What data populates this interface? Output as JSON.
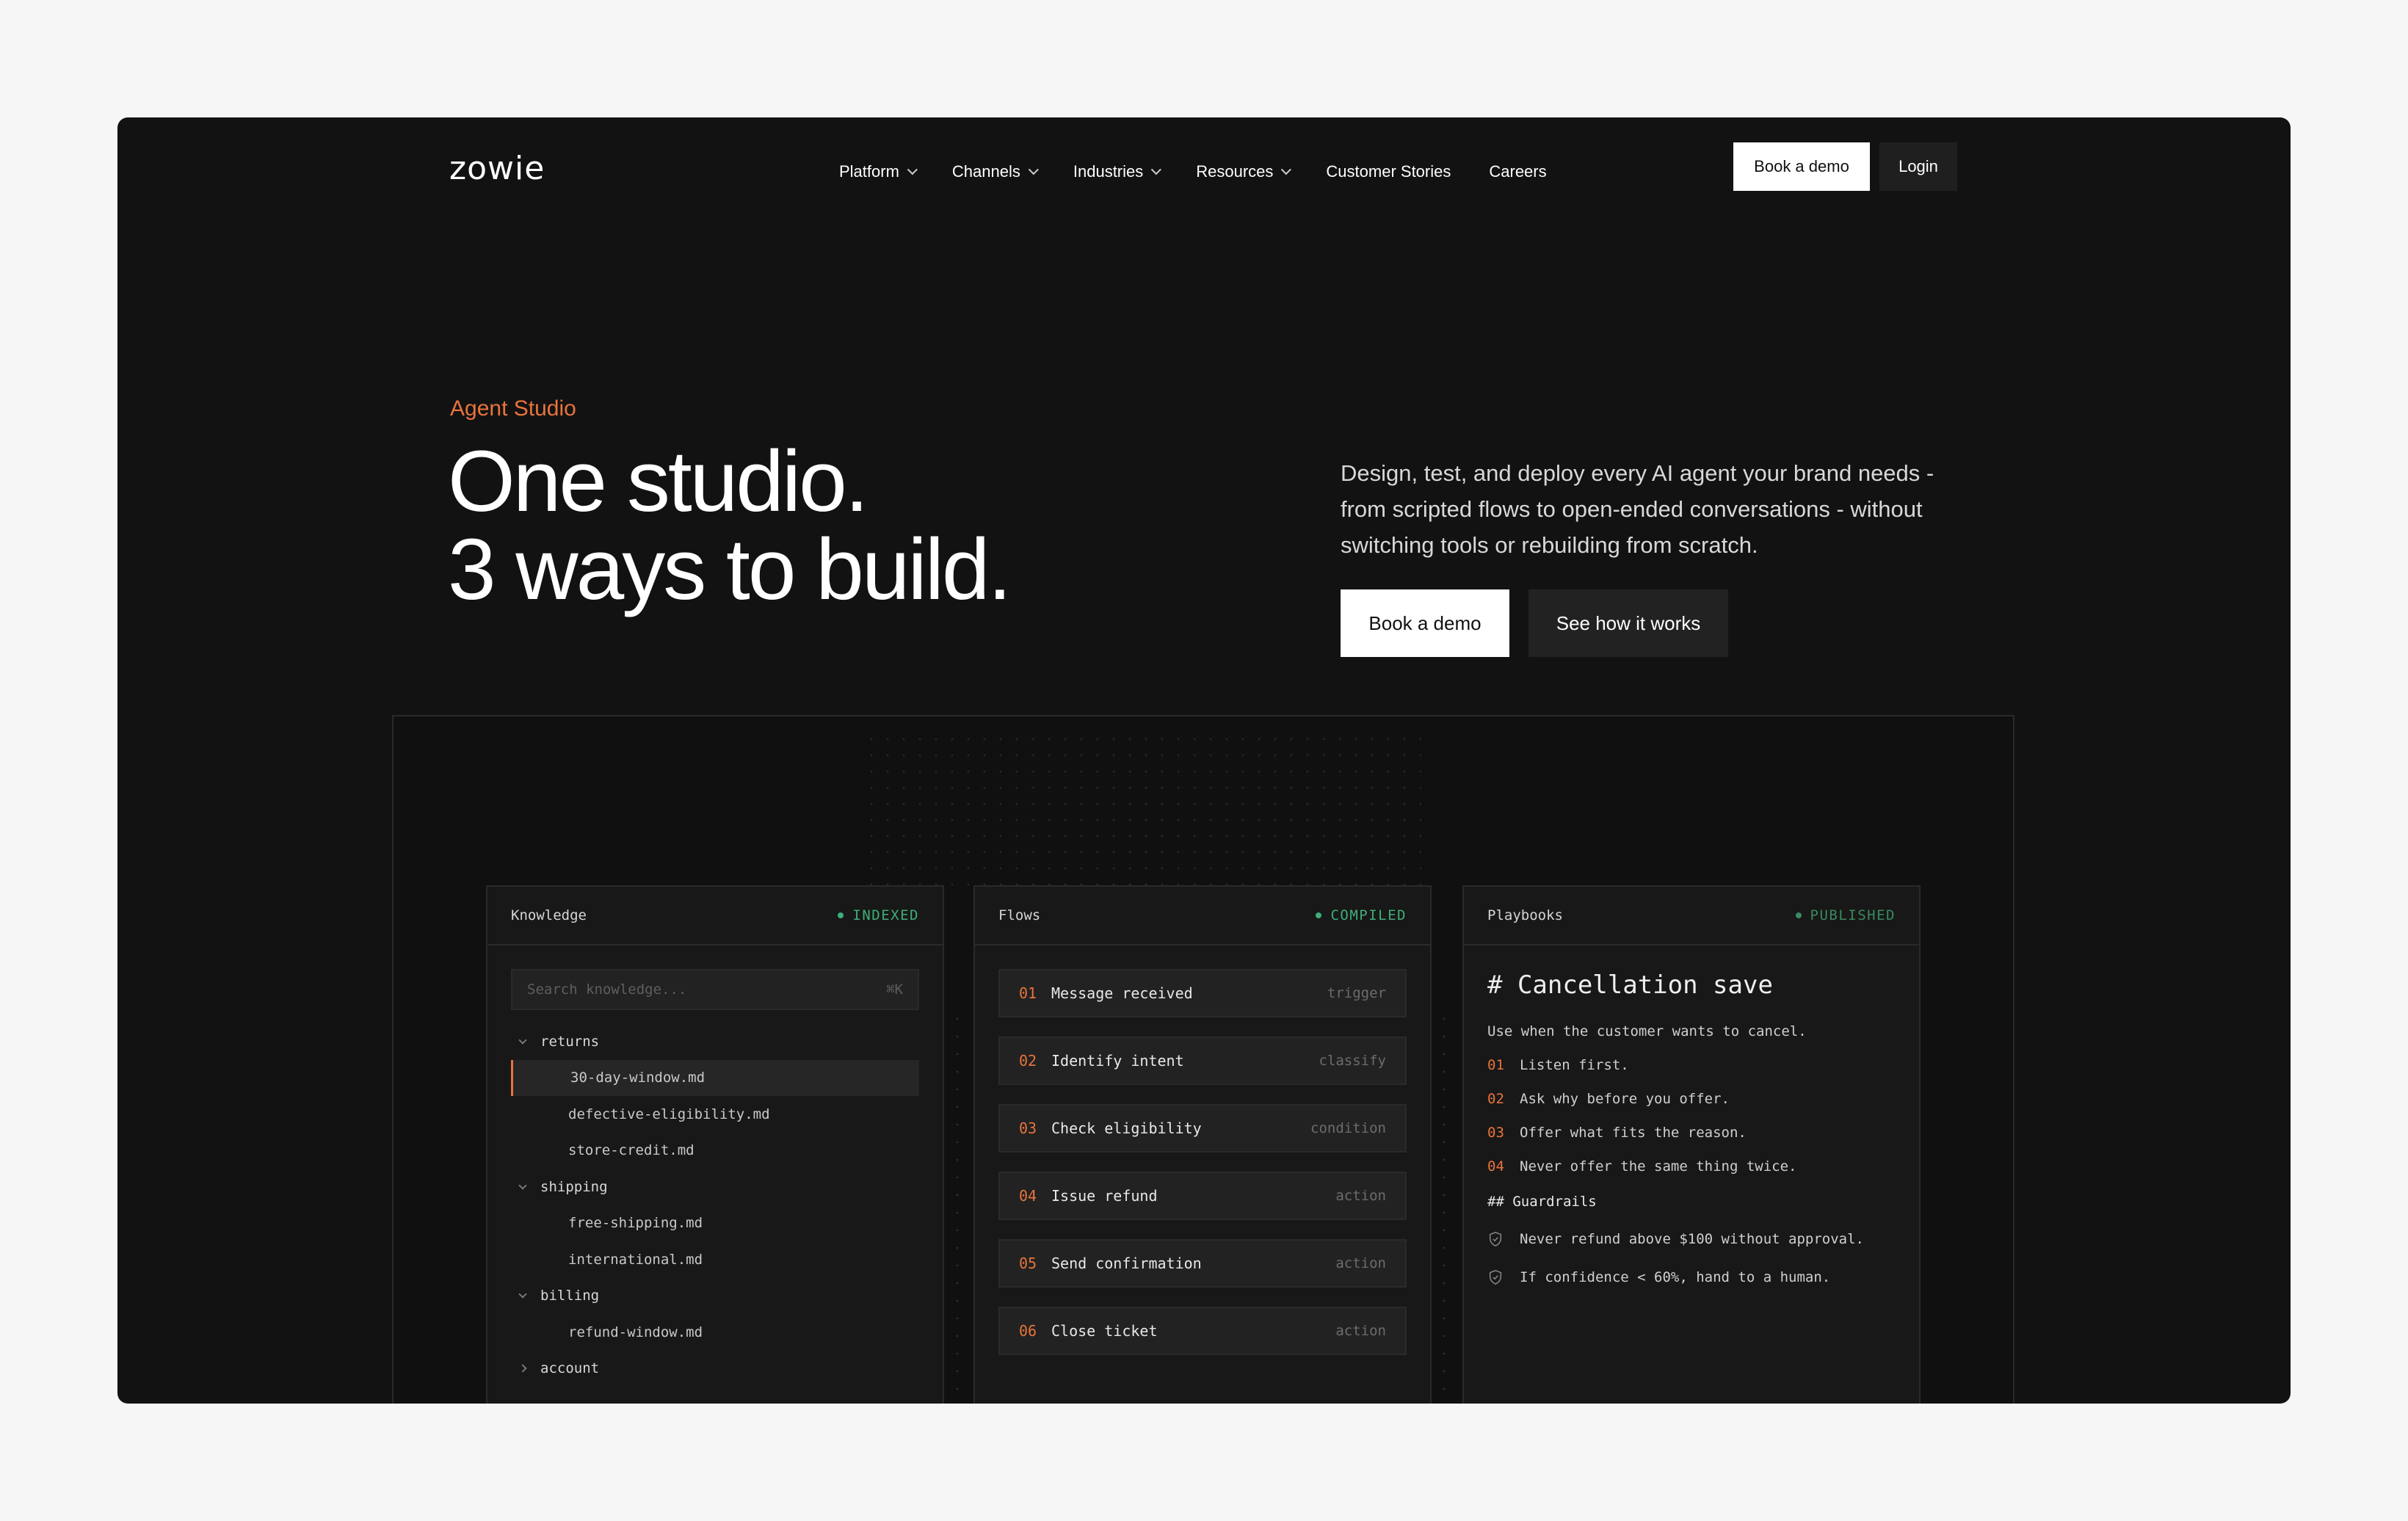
{
  "brand": {
    "logo": "zowie"
  },
  "nav": {
    "items": [
      {
        "label": "Platform",
        "dropdown": true
      },
      {
        "label": "Channels",
        "dropdown": true
      },
      {
        "label": "Industries",
        "dropdown": true
      },
      {
        "label": "Resources",
        "dropdown": true
      },
      {
        "label": "Customer Stories",
        "dropdown": false
      },
      {
        "label": "Careers",
        "dropdown": false
      }
    ],
    "book_demo": "Book a demo",
    "login": "Login"
  },
  "hero": {
    "eyebrow": "Agent Studio",
    "title_line1": "One studio.",
    "title_line2": "3 ways to build.",
    "subtitle": "Design, test, and deploy every AI agent your brand needs - from scripted flows to open-ended conversations - without switching tools or rebuilding from scratch.",
    "cta_primary": "Book a demo",
    "cta_secondary": "See how it works"
  },
  "colors": {
    "accent": "#e8743d",
    "status_green": "#3fae77",
    "background": "#121212"
  },
  "knowledge": {
    "title": "Knowledge",
    "status": "INDEXED",
    "search_placeholder": "Search knowledge...",
    "shortcut": "⌘K",
    "tree": [
      {
        "type": "folder",
        "label": "returns",
        "open": true
      },
      {
        "type": "file",
        "label": "30-day-window.md",
        "active": true
      },
      {
        "type": "file",
        "label": "defective-eligibility.md"
      },
      {
        "type": "file",
        "label": "store-credit.md"
      },
      {
        "type": "folder",
        "label": "shipping",
        "open": true
      },
      {
        "type": "file",
        "label": "free-shipping.md"
      },
      {
        "type": "file",
        "label": "international.md"
      },
      {
        "type": "folder",
        "label": "billing",
        "open": true
      },
      {
        "type": "file",
        "label": "refund-window.md"
      },
      {
        "type": "folder",
        "label": "account",
        "open": false
      }
    ]
  },
  "flows": {
    "title": "Flows",
    "status": "COMPILED",
    "steps": [
      {
        "num": "01",
        "label": "Message received",
        "tag": "trigger"
      },
      {
        "num": "02",
        "label": "Identify intent",
        "tag": "classify"
      },
      {
        "num": "03",
        "label": "Check eligibility",
        "tag": "condition"
      },
      {
        "num": "04",
        "label": "Issue refund",
        "tag": "action"
      },
      {
        "num": "05",
        "label": "Send confirmation",
        "tag": "action"
      },
      {
        "num": "06",
        "label": "Close ticket",
        "tag": "action"
      }
    ]
  },
  "playbooks": {
    "title": "Playbooks",
    "status": "PUBLISHED",
    "heading": "# Cancellation save",
    "intro": "Use when the customer wants to cancel.",
    "steps": [
      {
        "num": "01",
        "text": "Listen first."
      },
      {
        "num": "02",
        "text": "Ask why before you offer."
      },
      {
        "num": "03",
        "text": "Offer what fits the reason."
      },
      {
        "num": "04",
        "text": "Never offer the same thing twice."
      }
    ],
    "guardrails_heading": "## Guardrails",
    "guardrails": [
      "Never refund above $100 without approval.",
      "If confidence < 60%, hand to a human."
    ]
  }
}
